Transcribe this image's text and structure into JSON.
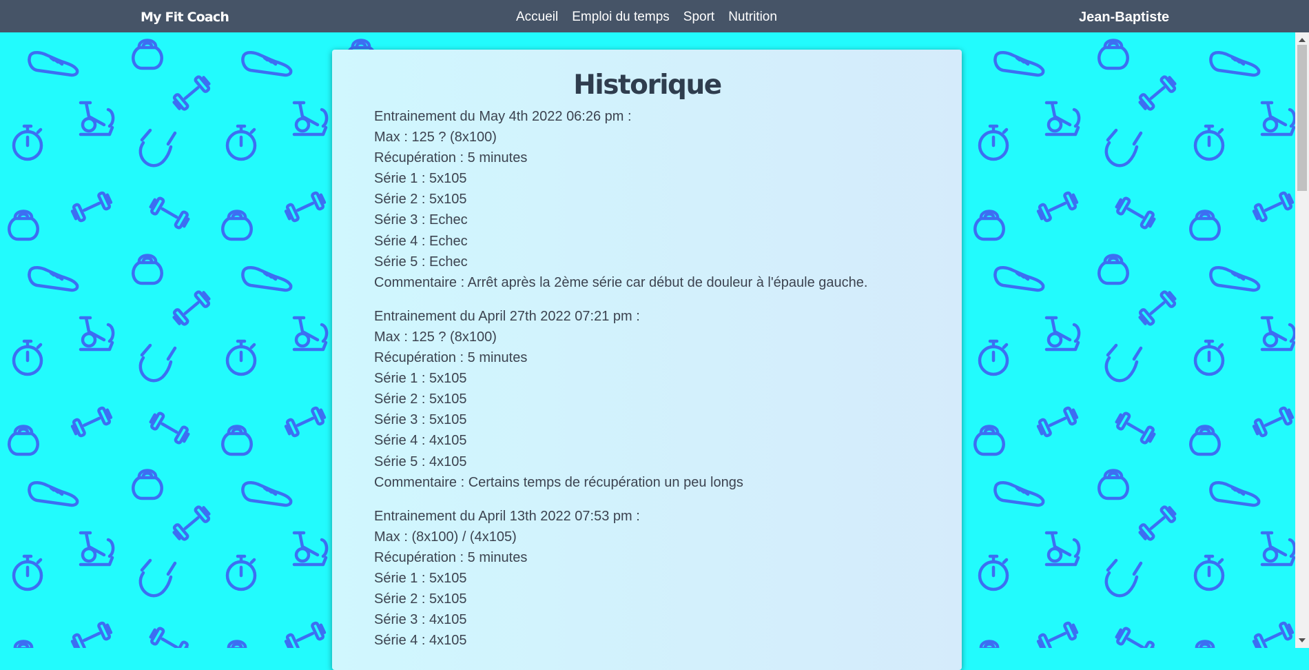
{
  "navbar": {
    "brand": "My Fit Coach",
    "links": [
      "Accueil",
      "Emploi du temps",
      "Sport",
      "Nutrition"
    ],
    "user": "Jean-Baptiste"
  },
  "colors": {
    "background": "#22fbfd",
    "pattern_icons": "#3d6ef2",
    "navbar": "#465467",
    "card_gradient_start": "#d0f7fe",
    "card_gradient_end": "#d5ebfb",
    "text": "#3c4350"
  },
  "background_icons": [
    "sneaker-icon",
    "kettlebell-icon",
    "dumbbell-icon",
    "exercise-bike-icon",
    "stopwatch-icon",
    "jump-rope-icon"
  ],
  "history": {
    "title": "Historique",
    "sessions": [
      {
        "header": "Entrainement du May 4th 2022 06:26 pm :",
        "max": "Max : 125 ? (8x100)",
        "recovery": "Récupération : 5 minutes",
        "series": [
          "Série 1 : 5x105",
          "Série 2 : 5x105",
          "Série 3 : Echec",
          "Série 4 : Echec",
          "Série 5 : Echec"
        ],
        "comment": "Commentaire : Arrêt après la 2ème série car début de douleur à l'épaule gauche."
      },
      {
        "header": "Entrainement du April 27th 2022 07:21 pm :",
        "max": "Max : 125 ? (8x100)",
        "recovery": "Récupération : 5 minutes",
        "series": [
          "Série 1 : 5x105",
          "Série 2 : 5x105",
          "Série 3 : 5x105",
          "Série 4 : 4x105",
          "Série 5 : 4x105"
        ],
        "comment": "Commentaire : Certains temps de récupération un peu longs"
      },
      {
        "header": "Entrainement du April 13th 2022 07:53 pm :",
        "max": "Max : (8x100) / (4x105)",
        "recovery": "Récupération : 5 minutes",
        "series": [
          "Série 1 : 5x105",
          "Série 2 : 5x105",
          "Série 3 : 4x105",
          "Série 4 : 4x105"
        ],
        "comment": ""
      }
    ]
  }
}
